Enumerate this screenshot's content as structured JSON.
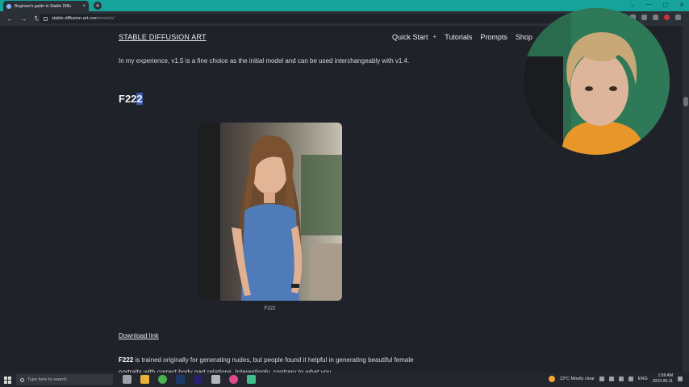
{
  "browser": {
    "tab_title": "Beginner's guide to Stable Diffu",
    "tab_close": "×",
    "new_tab": "+",
    "window_controls": [
      "⌄",
      "—",
      "▢",
      "✕"
    ],
    "url_host": "stable-diffusion-art.com",
    "url_path": "/models/",
    "nav": {
      "back": "←",
      "forward": "→",
      "reload": "↻"
    }
  },
  "site": {
    "brand": "STABLE DIFFUSION ART",
    "nav": [
      "Quick Start",
      "+",
      "Tutorials",
      "Prompts",
      "Shop"
    ]
  },
  "article": {
    "para1": "In my experience, v1.5 is a fine choice as the initial model and can be used interchangeably with v1.4.",
    "heading_prefix": "F22",
    "heading_selected": "2",
    "image_caption": "F222",
    "download_link": "Download link",
    "para2_bold": "F222",
    "para2_rest": " is trained originally for generating nudes, but people found it helpful in generating beautiful female portraits with correct body part relations. Interestingly, contrary to what you"
  },
  "taskbar": {
    "search_placeholder": "Type here to search",
    "weather": "13°C  Mostly clear",
    "language": "ENG",
    "time": "1:56 AM",
    "date": "2023-05-11"
  },
  "colors": {
    "tab_accent": "#16a39b",
    "page_bg": "#1f2229",
    "selection": "#3b5aa8"
  },
  "icons": [
    "start-icon",
    "search-icon",
    "weather-icon",
    "lock-icon"
  ]
}
